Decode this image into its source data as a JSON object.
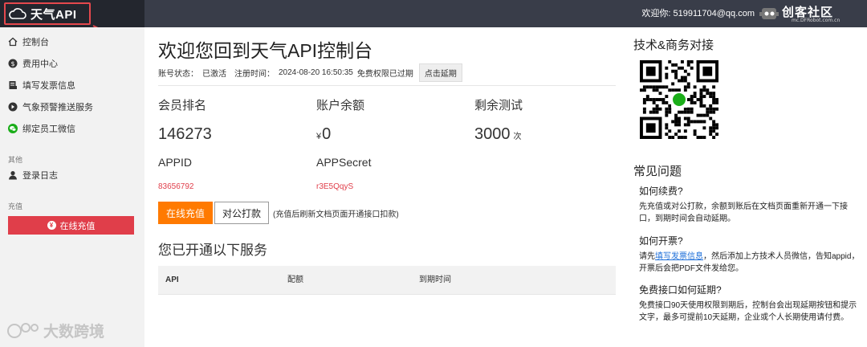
{
  "header": {
    "logo_text": "天气API",
    "welcome": "欢迎你:",
    "email": "519911704@qq.com",
    "community_title": "创客社区",
    "community_url": "mc.DFRobot.com.cn"
  },
  "sidebar": {
    "items": [
      {
        "label": "控制台",
        "icon": "home-icon"
      },
      {
        "label": "费用中心",
        "icon": "dollar-icon"
      },
      {
        "label": "填写发票信息",
        "icon": "invoice-icon"
      },
      {
        "label": "气象预警推送服务",
        "icon": "send-icon"
      },
      {
        "label": "绑定员工微信",
        "icon": "wechat-icon"
      }
    ],
    "group_other": "其他",
    "login_log": "登录日志",
    "group_recharge": "充值",
    "recharge_button": "在线充值",
    "watermark": "大数跨境"
  },
  "main": {
    "title": "欢迎您回到天气API控制台",
    "account_status_label": "账号状态：",
    "account_status": "已激活",
    "register_label": "注册时间：",
    "register_time": "2024-08-20 16:50:35",
    "expired_note": "免费权限已过期",
    "extend_button": "点击延期",
    "stats": {
      "rank_label": "会员排名",
      "rank_value": "146273",
      "balance_label": "账户余额",
      "balance_symbol": "¥",
      "balance_value": "0",
      "tests_label": "剩余测试",
      "tests_value": "3000",
      "tests_unit": "次"
    },
    "keys": {
      "appid_label": "APPID",
      "appid_value": "83656792",
      "secret_label": "APPSecret",
      "secret_value": "r3E5QqyS"
    },
    "pay_online": "在线充值",
    "pay_transfer": "对公打款",
    "pay_note": "(充值后刷新文档页面开通接口扣款)",
    "services_title": "您已开通以下服务",
    "table_headers": [
      "API",
      "配额",
      "到期时间"
    ]
  },
  "right": {
    "contact_title": "技术&商务对接",
    "faq_title": "常见问题",
    "faqs": [
      {
        "q": "如何续费?",
        "a": "先充值或对公打款，余额到账后在文档页面重新开通一下接口，到期时间会自动延期。"
      },
      {
        "q": "如何开票?",
        "a_prefix": "请先",
        "a_link": "填写发票信息",
        "a_suffix": "，然后添加上方技术人员微信，告知appid，开票后会把PDF文件发给您。"
      },
      {
        "q": "免费接口如何延期?",
        "a": "免费接口90天使用权限到期后，控制台会出现延期按钮和提示文字，最多可提前10天延期，企业或个人长期使用请付费。"
      }
    ]
  },
  "colors": {
    "topbar": "#393d49",
    "logo_bg": "#23262e",
    "accent_red": "#e03e4a",
    "accent_orange": "#ff7a00",
    "link_blue": "#1e6fd9"
  }
}
